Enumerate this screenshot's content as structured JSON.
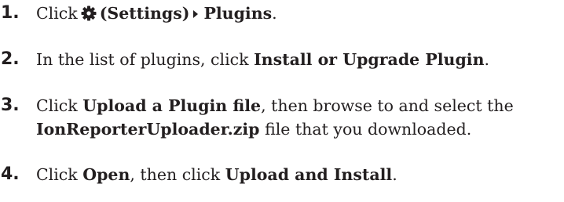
{
  "steps": [
    {
      "number": "1.",
      "click": "Click",
      "settings_label": "(Settings)",
      "plugins_label": "Plugins",
      "end": "."
    },
    {
      "number": "2.",
      "lead": "In the list of plugins, click",
      "bold": "Install or Upgrade Plugin",
      "end": "."
    },
    {
      "number": "3.",
      "click": "Click",
      "bold1": "Upload a Plugin file",
      "mid": ", then browse to and select the",
      "bold2": "IonReporterUploader.zip",
      "tail": "file that you downloaded."
    },
    {
      "number": "4.",
      "click": "Click",
      "bold1": "Open",
      "mid": ", then click",
      "bold2": "Upload and Install",
      "end": "."
    }
  ],
  "icons": {
    "settings": "gear-icon",
    "separator": "right-triangle-icon"
  },
  "colors": {
    "text": "#231f20"
  }
}
